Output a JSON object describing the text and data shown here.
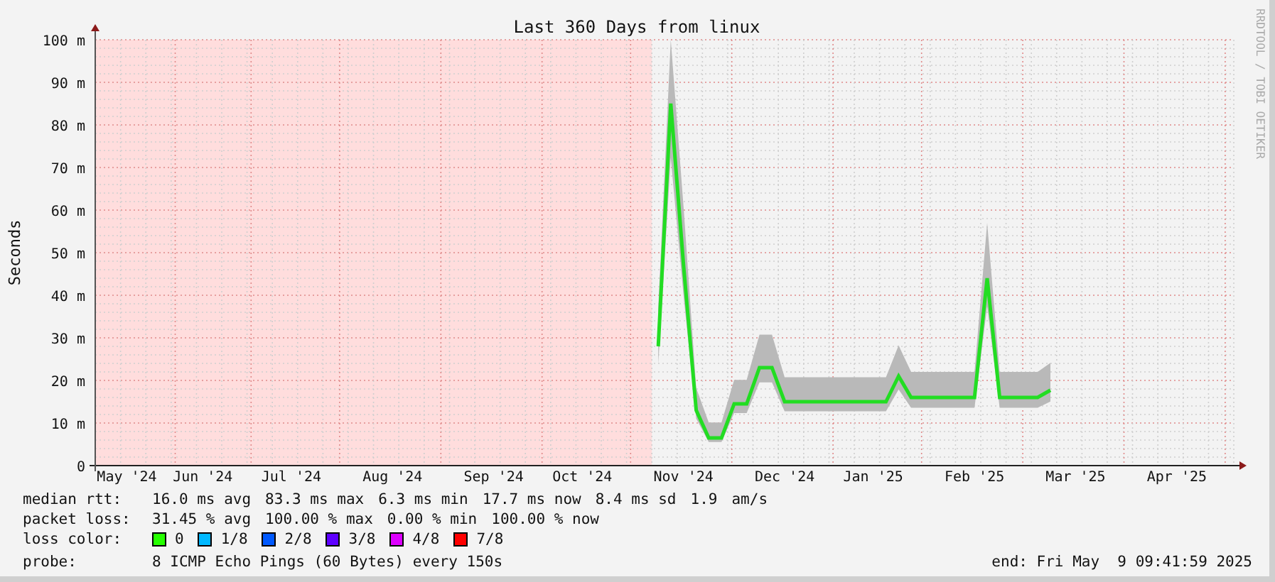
{
  "chart": {
    "chart_data": {
      "type": "line",
      "grid": true,
      "title": "Last 360 Days from linux",
      "ylabel": "Seconds",
      "ylim": [
        0,
        100
      ],
      "categories": [
        null,
        null,
        "May '24",
        null,
        null,
        null,
        null,
        null,
        "Jun '24",
        null,
        null,
        null,
        null,
        null,
        null,
        "Jul '24",
        null,
        null,
        null,
        null,
        null,
        null,
        null,
        "Aug '24",
        null,
        null,
        null,
        null,
        null,
        null,
        null,
        "Sep '24",
        null,
        null,
        null,
        null,
        null,
        null,
        "Oct '24",
        null,
        null,
        null,
        null,
        null,
        null,
        null,
        "Nov '24",
        null,
        null,
        null,
        null,
        null,
        null,
        null,
        "Dec '24",
        null,
        null,
        null,
        null,
        null,
        null,
        "Jan '25",
        null,
        null,
        null,
        null,
        null,
        null,
        null,
        "Feb '25",
        null,
        null,
        null,
        null,
        null,
        null,
        null,
        "Mar '25",
        null,
        null,
        null,
        null,
        null,
        null,
        null,
        "Apr '25",
        null,
        null,
        null,
        null
      ],
      "yticks": [
        {
          "value": 0,
          "label": "0"
        },
        {
          "value": 10,
          "label": "10 m"
        },
        {
          "value": 20,
          "label": "20 m"
        },
        {
          "value": 30,
          "label": "30 m"
        },
        {
          "value": 40,
          "label": "40 m"
        },
        {
          "value": 50,
          "label": "50 m"
        },
        {
          "value": 60,
          "label": "60 m"
        },
        {
          "value": 70,
          "label": "70 m"
        },
        {
          "value": 80,
          "label": "80 m"
        },
        {
          "value": 90,
          "label": "90 m"
        },
        {
          "value": 100,
          "label": "100 m"
        }
      ],
      "series": [
        {
          "name": "median rtt:",
          "color": "#22dd22",
          "values": [
            null,
            null,
            null,
            null,
            null,
            null,
            null,
            null,
            null,
            null,
            null,
            null,
            null,
            null,
            null,
            null,
            null,
            null,
            null,
            null,
            null,
            null,
            null,
            null,
            null,
            null,
            null,
            null,
            null,
            null,
            null,
            null,
            null,
            null,
            null,
            null,
            null,
            null,
            null,
            null,
            null,
            null,
            null,
            null,
            28,
            85,
            47,
            13,
            6.5,
            6.5,
            14.5,
            14.5,
            23,
            23,
            15,
            15,
            15,
            15,
            15,
            15,
            15,
            15,
            15,
            21,
            16,
            16,
            16,
            16,
            16,
            16,
            44,
            16,
            16,
            16,
            16,
            17.7,
            null,
            null,
            null,
            null,
            null,
            null,
            null,
            null,
            null,
            null,
            null,
            null,
            null,
            null
          ]
        }
      ]
    }
  },
  "credit": "RRDTOOL / TOBI OETIKER",
  "legend": {
    "median_rtt": {
      "values": [
        "16.0 ms avg",
        "83.3 ms max",
        "6.3 ms min",
        "17.7 ms now",
        "8.4 ms sd",
        "1.9",
        "am/s"
      ]
    },
    "packet_loss": {
      "label": "packet loss:",
      "values": [
        "31.45 % avg",
        "100.00 % max",
        "0.00 % min",
        "100.00 % now"
      ]
    },
    "loss_color": {
      "label": "loss color:",
      "items": [
        {
          "label": "0",
          "color": "#26ff00"
        },
        {
          "label": "1/8",
          "color": "#00b8ff"
        },
        {
          "label": "2/8",
          "color": "#0059ff"
        },
        {
          "label": "3/8",
          "color": "#5e00ff"
        },
        {
          "label": "4/8",
          "color": "#dd00ff"
        },
        {
          "label": "7/8",
          "color": "#ff0000"
        }
      ]
    },
    "probe": {
      "label": "probe:",
      "value": "8 ICMP Echo Pings (60 Bytes) every 150s"
    },
    "end": "end: Fri May  9 09:41:59 2025"
  }
}
